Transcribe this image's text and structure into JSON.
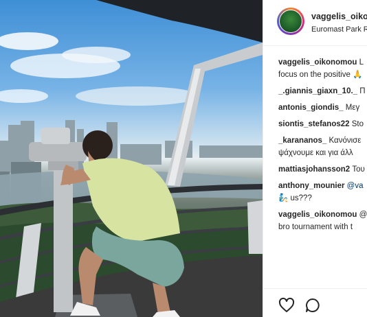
{
  "post": {
    "username": "vaggelis_oikonomou",
    "location": "Euromast Park R",
    "photo_alt": "Man looking through coin-operated binoculars over Rotterdam skyline"
  },
  "comments": [
    {
      "user": "vaggelis_oikonomou",
      "text": " L",
      "text2": "focus on the positive 🙏"
    },
    {
      "user": "_.giannis_giaxn_10._",
      "text": " Π"
    },
    {
      "user": "antonis_giondis_",
      "text": " Μεγ"
    },
    {
      "user": "siontis_stefanos22",
      "text": " Sto"
    },
    {
      "user": "_karananos_",
      "text": " Κανόνισε",
      "text2": "ψάχνουμε και για άλλ"
    },
    {
      "user": "mattiasjohansson2",
      "text": " Του"
    },
    {
      "user": "anthony_mounier",
      "mention": " @va",
      "text2": "🧞 us???"
    },
    {
      "user": "vaggelis_oikonomou",
      "text": " @",
      "text2": "bro tournament with t"
    }
  ],
  "icons": {
    "like": "heart-icon",
    "comment": "comment-bubble-icon"
  }
}
